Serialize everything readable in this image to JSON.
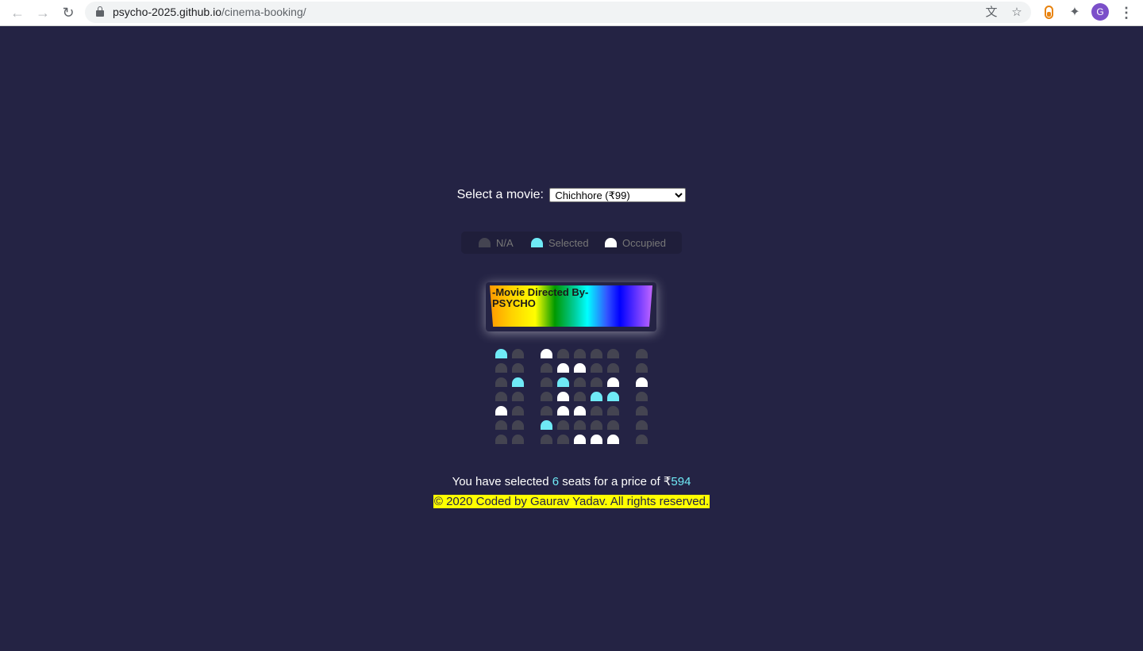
{
  "browser": {
    "url_domain": "psycho-2025.github.io",
    "url_path": "/cinema-booking/",
    "profile_initial": "G",
    "icons": [
      "back-icon",
      "forward-icon",
      "reload-icon",
      "lock-icon",
      "translate-icon",
      "star-icon",
      "extension-icon",
      "puzzle-icon",
      "menu-icon"
    ]
  },
  "movie_select": {
    "label": "Select a movie:",
    "selected_option": "Chichhore (₹99)"
  },
  "legend": {
    "na": "N/A",
    "selected": "Selected",
    "occupied": "Occupied"
  },
  "screen": {
    "text_line1": "-Movie Directed By-",
    "text_line2": "PSYCHO"
  },
  "seats": {
    "rows": [
      [
        "selected",
        "na",
        "occupied",
        "na",
        "na",
        "na",
        "na",
        "na"
      ],
      [
        "na",
        "na",
        "na",
        "occupied",
        "occupied",
        "na",
        "na",
        "na"
      ],
      [
        "na",
        "selected",
        "na",
        "selected",
        "na",
        "na",
        "occupied",
        "occupied"
      ],
      [
        "na",
        "na",
        "na",
        "occupied",
        "na",
        "selected",
        "selected",
        "na"
      ],
      [
        "occupied",
        "na",
        "na",
        "occupied",
        "occupied",
        "na",
        "na",
        "na"
      ],
      [
        "na",
        "na",
        "selected",
        "na",
        "na",
        "na",
        "na",
        "na"
      ],
      [
        "na",
        "na",
        "na",
        "na",
        "occupied",
        "occupied",
        "occupied",
        "na"
      ]
    ]
  },
  "summary": {
    "prefix": "You have selected",
    "count": "6",
    "middle": "seats for a price of ₹",
    "total": "594"
  },
  "footer": {
    "text": "© 2020 Coded by Gaurav Yadav. All rights reserved."
  },
  "colors": {
    "background": "#242344",
    "seat_na": "#444451",
    "seat_selected": "#6feaf6",
    "seat_occupied": "#ffffff",
    "footer_highlight": "#ffff00"
  }
}
